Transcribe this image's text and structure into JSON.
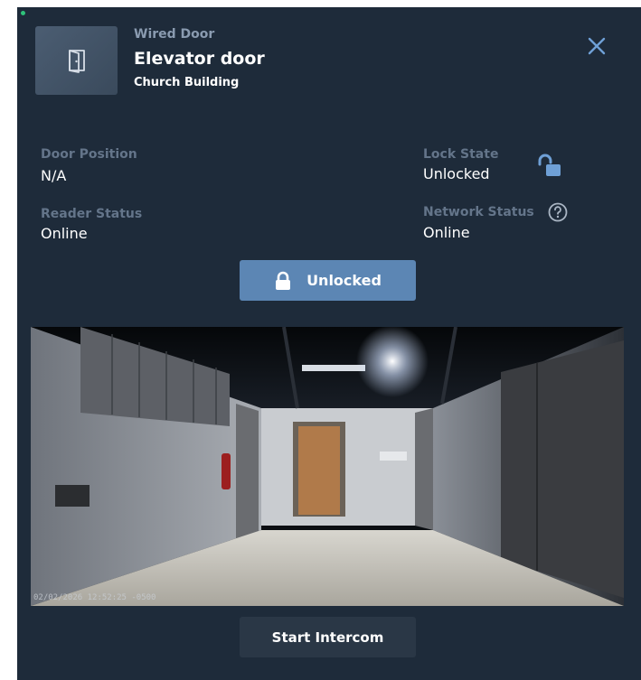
{
  "header": {
    "door_type": "Wired Door",
    "door_name": "Elevator door",
    "building": "Church Building"
  },
  "status": {
    "door_position_label": "Door Position",
    "door_position_value": "N/A",
    "lock_state_label": "Lock State",
    "lock_state_value": "Unlocked",
    "reader_status_label": "Reader Status",
    "reader_status_value": "Online",
    "network_status_label": "Network Status",
    "network_status_value": "Online"
  },
  "actions": {
    "lock_button_label": "Unlocked",
    "intercom_button_label": "Start Intercom"
  },
  "camera": {
    "timestamp": "02/02/2026 12:52:25 -0500"
  },
  "colors": {
    "panel_bg": "#1e2b3a",
    "accent_blue": "#5c86b4",
    "label_gray": "#64758a",
    "online_dot": "#2fc27a"
  },
  "icons": {
    "door": "door-icon",
    "close": "close-icon",
    "lock_state": "lock-open-icon",
    "network_help": "help-circle-icon",
    "lock_button": "lock-icon"
  }
}
